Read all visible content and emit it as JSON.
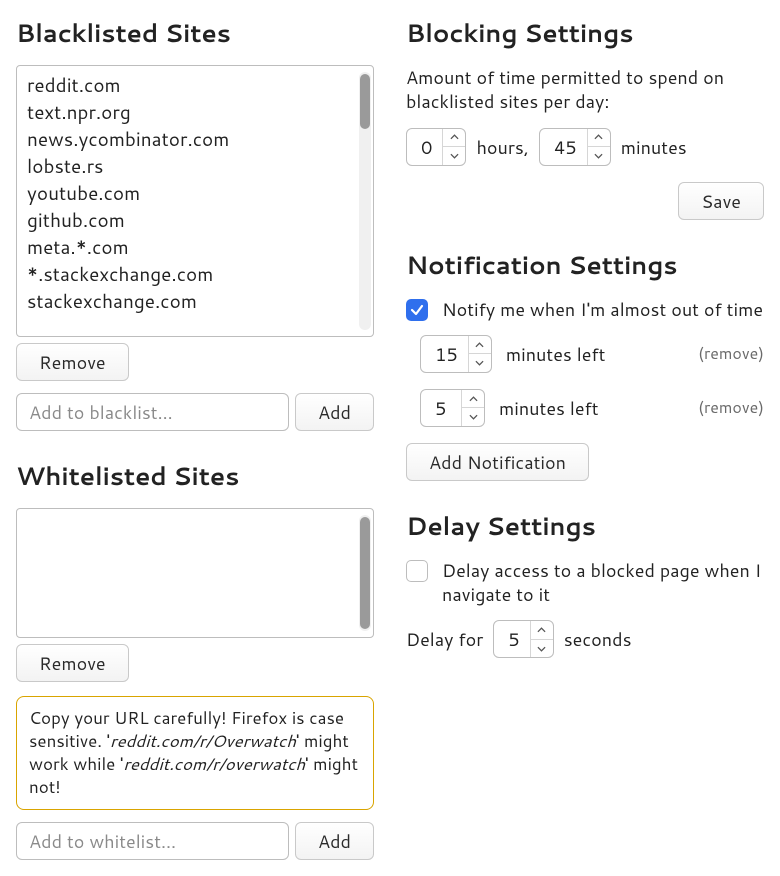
{
  "blacklist": {
    "heading": "Blacklisted Sites",
    "items": [
      "reddit.com",
      "text.npr.org",
      "news.ycombinator.com",
      "lobste.rs",
      "youtube.com",
      "github.com",
      "meta.*.com",
      "*.stackexchange.com",
      "stackexchange.com"
    ],
    "remove_label": "Remove",
    "add_placeholder": "Add to blacklist...",
    "add_label": "Add"
  },
  "whitelist": {
    "heading": "Whitelisted Sites",
    "remove_label": "Remove",
    "warning_prefix": "Copy your URL carefully! Firefox is case sensitive. '",
    "warning_ex1": "reddit.com/r/Overwatch",
    "warning_mid": "' might work while '",
    "warning_ex2": "reddit.com/r/overwatch",
    "warning_suffix": "' might not!",
    "add_placeholder": "Add to whitelist...",
    "add_label": "Add"
  },
  "blocking": {
    "heading": "Blocking Settings",
    "desc": "Amount of time permitted to spend on blacklisted sites per day:",
    "hours_value": "0",
    "hours_label": "hours,",
    "minutes_value": "45",
    "minutes_label": "minutes",
    "save_label": "Save"
  },
  "notifications": {
    "heading": "Notification Settings",
    "enable_checked": true,
    "enable_label": "Notify me when I'm almost out of time",
    "rows": [
      {
        "value": "15",
        "label": "minutes left",
        "remove": "(remove)"
      },
      {
        "value": "5",
        "label": "minutes left",
        "remove": "(remove)"
      }
    ],
    "add_label": "Add Notification"
  },
  "delay": {
    "heading": "Delay Settings",
    "enable_checked": false,
    "enable_label": "Delay access to a blocked page when I navigate to it",
    "prefix": "Delay for",
    "value": "5",
    "suffix": "seconds"
  }
}
